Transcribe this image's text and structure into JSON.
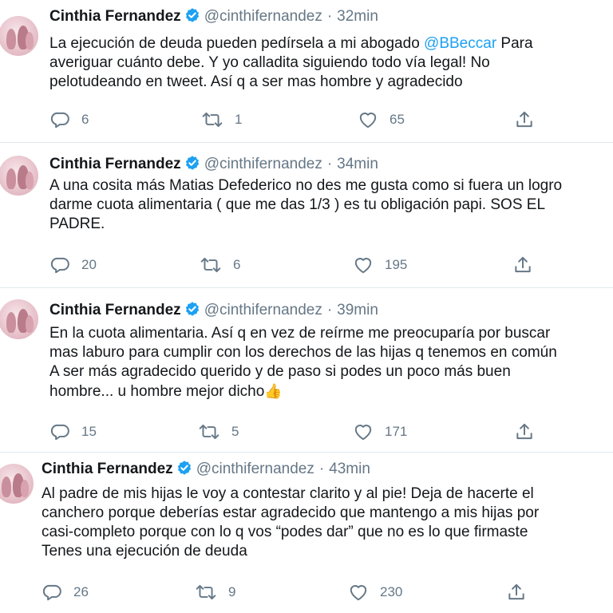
{
  "tweets": [
    {
      "name": "Cinthia Fernandez",
      "handle": "@cinthifernandez",
      "separator": "·",
      "time": "32min",
      "lines": [
        {
          "before": "La ejecución de deuda pueden pedírsela a mi abogado ",
          "mention": "@BBeccar",
          "after": " Para"
        },
        {
          "before": "averiguar cuánto debe. Y yo calladita siguiendo todo vía legal! No"
        },
        {
          "before": "pelotudeando en tweet. Así q a ser mas hombre y agradecido"
        }
      ],
      "replies": "6",
      "retweets": "1",
      "likes": "65"
    },
    {
      "name": "Cinthia Fernandez",
      "handle": "@cinthifernandez",
      "separator": "·",
      "time": "34min",
      "lines": [
        {
          "before": "A una cosita más Matias Defederico no des me gusta como si fuera un logro"
        },
        {
          "before": "darme cuota alimentaria ( que me das 1/3 ) es tu obligación papi. SOS EL"
        },
        {
          "before": "PADRE."
        }
      ],
      "replies": "20",
      "retweets": "6",
      "likes": "195"
    },
    {
      "name": "Cinthia Fernandez",
      "handle": "@cinthifernandez",
      "separator": "·",
      "time": "39min",
      "lines": [
        {
          "before": "En la cuota alimentaria. Así q en vez de reírme me preocuparía por buscar"
        },
        {
          "before": "mas laburo para cumplir con los derechos de las hijas q tenemos en común"
        },
        {
          "before": "A ser más agradecido querido y de paso si podes un poco más buen"
        },
        {
          "before": "hombre... u hombre mejor dicho",
          "emoji": "👍"
        }
      ],
      "replies": "15",
      "retweets": "5",
      "likes": "171"
    },
    {
      "name": "Cinthia Fernandez",
      "handle": "@cinthifernandez",
      "separator": "·",
      "time": "43min",
      "lines": [
        {
          "before": "Al padre de mis hijas le voy a contestar clarito y al pie! Deja de hacerte el"
        },
        {
          "before": "canchero porque deberías estar agradecido que mantengo a mis hijas por"
        },
        {
          "before": "casi-completo porque con lo q vos  “podes dar” que no es lo que firmaste"
        },
        {
          "before": "Tenes una ejecución de deuda"
        }
      ],
      "replies": "26",
      "retweets": "9",
      "likes": "230"
    }
  ],
  "icons": {
    "reply": "reply-icon",
    "retweet": "retweet-icon",
    "like": "like-icon",
    "share": "share-icon",
    "verified": "verified-badge-icon"
  },
  "colors": {
    "verified": "#1da1f2",
    "mention": "#1da1f2",
    "muted": "#657786",
    "divider": "#e1e8ed"
  }
}
